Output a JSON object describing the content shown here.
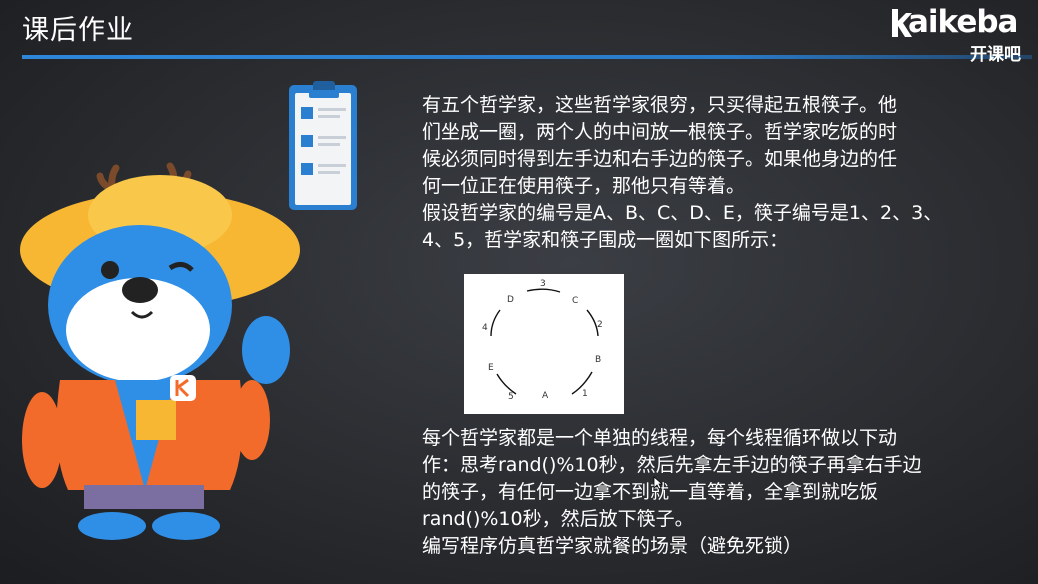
{
  "slide": {
    "title": "课后作业"
  },
  "logo": {
    "wordmark": "aikeba",
    "subtitle": "开课吧",
    "accent": "#2f86d8"
  },
  "problem": {
    "lines_1": [
      "有五个哲学家，这些哲学家很穷，只买得起五根筷子。他",
      "们坐成一圈，两个人的中间放一根筷子。哲学家吃饭的时",
      "候必须同时得到左手边和右手边的筷子。如果他身边的任",
      "何一位正在使用筷子，那他只有等着。",
      "假设哲学家的编号是A、B、C、D、E，筷子编号是1、2、3、",
      "4、5，哲学家和筷子围成一圈如下图所示："
    ],
    "lines_2": [
      "每个哲学家都是一个单独的线程，每个线程循环做以下动",
      "作：思考rand()%10秒，然后先拿左手边的筷子再拿右手边",
      "的筷子，有任何一边拿不到就一直等着，全拿到就吃饭",
      "rand()%10秒，然后放下筷子。",
      "编写程序仿真哲学家就餐的场景（避免死锁）"
    ]
  },
  "diagram": {
    "philosophers": [
      "A",
      "B",
      "C",
      "D",
      "E"
    ],
    "chopsticks": [
      "1",
      "2",
      "3",
      "4",
      "5"
    ]
  },
  "icons": {
    "clipboard": "clipboard-checklist-icon",
    "mascot": "bear-mascot-illustration",
    "cursor": "mouse-cursor-icon"
  }
}
